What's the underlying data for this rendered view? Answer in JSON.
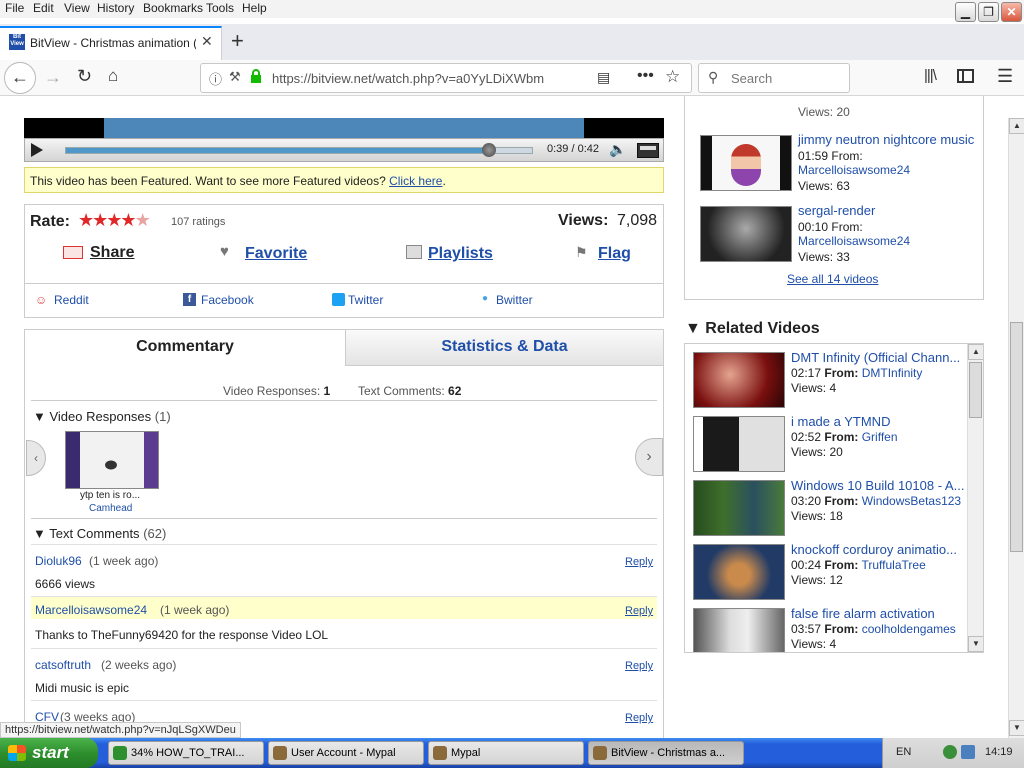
{
  "menu": [
    "File",
    "Edit",
    "View",
    "History",
    "Bookmarks",
    "Tools",
    "Help"
  ],
  "tab": {
    "favicon": "Bit View",
    "title": "BitView - Christmas animation (con"
  },
  "nav": {
    "url": "https://bitview.net/watch.php?v=a0YyLDiXWbm",
    "search_placeholder": "Search"
  },
  "player": {
    "time": "0:39 / 0:42",
    "progress": 0.91
  },
  "featured": {
    "text": "This video has been Featured. Want to see more Featured videos? ",
    "link": "Click here",
    "end": "."
  },
  "rating": {
    "label": "Rate:",
    "stars": 4.5,
    "ratings": "107 ratings",
    "views_label": "Views:",
    "views": "7,098"
  },
  "actions": {
    "share": "Share",
    "favorite": "Favorite",
    "playlists": "Playlists",
    "flag": "Flag"
  },
  "social": {
    "reddit": "Reddit",
    "facebook": "Facebook",
    "twitter": "Twitter",
    "bwitter": "Bwitter"
  },
  "tabs": {
    "commentary": "Commentary",
    "stats": "Statistics & Data"
  },
  "counts": {
    "vr_label": "Video Responses:",
    "vr": "1",
    "tc_label": "Text Comments:",
    "tc": "62"
  },
  "video_responses": {
    "title": "Video Responses",
    "count": "(1)",
    "item_title": "ytp ten is ro...",
    "item_user": "Camhead"
  },
  "text_comments": {
    "title": "Text Comments",
    "count": "(62)"
  },
  "comments": [
    {
      "user": "Dioluk96",
      "time": "(1 week ago)",
      "text": "6666 views",
      "reply": "Reply"
    },
    {
      "user": "Marcelloisawsome24",
      "time": "(1 week ago)",
      "text": "Thanks to TheFunny69420 for the response Video LOL",
      "reply": "Reply"
    },
    {
      "user": "catsoftruth",
      "time": "(2 weeks ago)",
      "text": "Midi music is epic",
      "reply": "Reply"
    },
    {
      "user": "CFV",
      "time": "(3 weeks ago)",
      "text": "",
      "reply": "Reply"
    }
  ],
  "more_from": [
    {
      "title": "",
      "time": "",
      "user": "",
      "views": "Views: 20"
    },
    {
      "title": "jimmy neutron nightcore music",
      "time": "01:59",
      "user": "Marcelloisawsome24",
      "views": "Views: 63"
    },
    {
      "title": "sergal-render",
      "time": "00:10",
      "user": "Marcelloisawsome24",
      "views": "Views: 33"
    }
  ],
  "from_label": "From:",
  "see_all": "See all 14 videos",
  "related_title": "Related Videos",
  "related": [
    {
      "title": "DMT Infinity (Official Chann...",
      "time": "02:17",
      "user": "DMTInfinity",
      "views": "Views: 4"
    },
    {
      "title": "i made a YTMND",
      "time": "02:52",
      "user": "Griffen",
      "views": "Views: 20"
    },
    {
      "title": "Windows 10 Build 10108 - A...",
      "time": "03:20",
      "user": "WindowsBetas123",
      "views": "Views: 18"
    },
    {
      "title": "knockoff corduroy animatio...",
      "time": "00:24",
      "user": "TruffulaTree",
      "views": "Views: 12"
    },
    {
      "title": "false fire alarm activation",
      "time": "03:57",
      "user": "coolholdengames",
      "views": "Views: 4"
    }
  ],
  "status_url": "https://bitview.net/watch.php?v=nJqLSgXWDeu",
  "taskbar": {
    "start": "start",
    "items": [
      "34% HOW_TO_TRAI...",
      "User Account - Mypal",
      "Mypal",
      "BitView - Christmas a..."
    ],
    "lang": "EN",
    "clock": "14:19"
  }
}
